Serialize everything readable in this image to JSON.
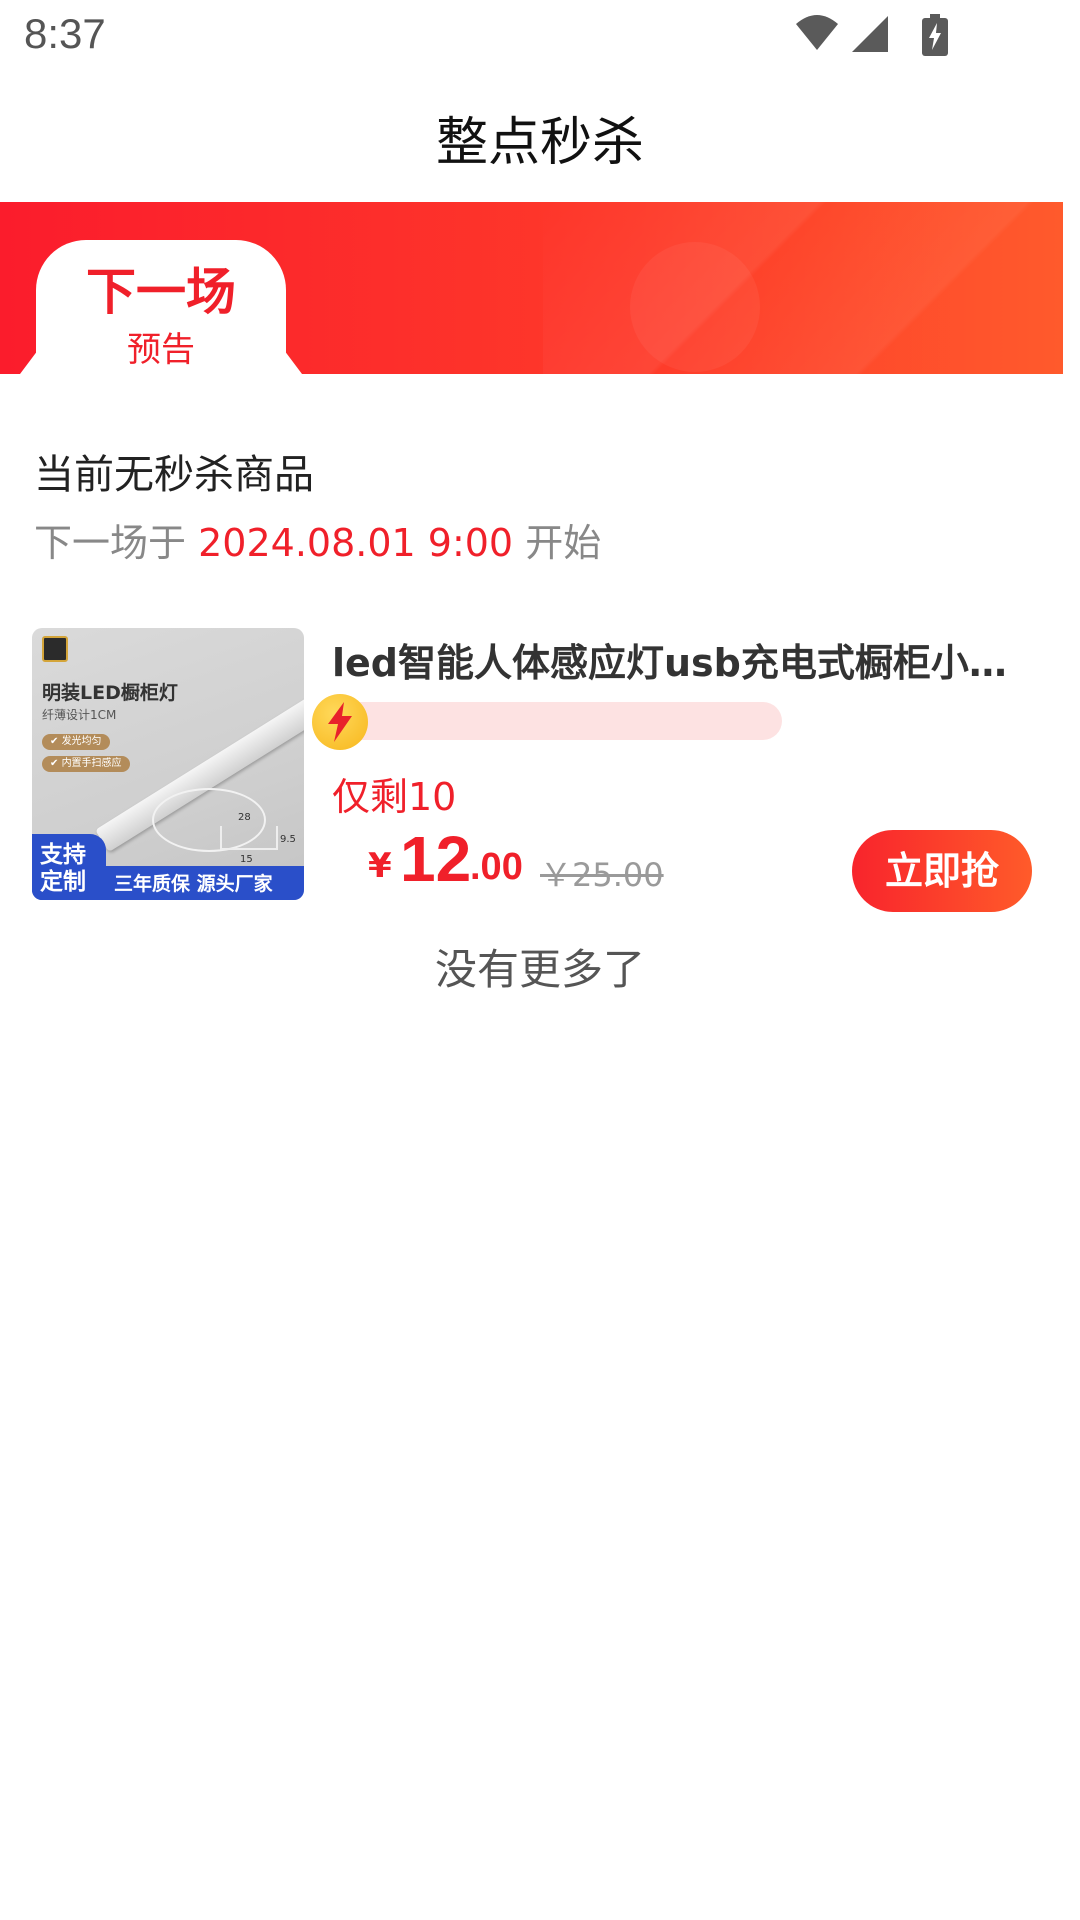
{
  "status_bar": {
    "time": "8:37",
    "icons": [
      "wifi-icon",
      "signal-icon",
      "battery-charging-icon"
    ]
  },
  "header": {
    "title": "整点秒杀"
  },
  "colors": {
    "accent": "#f0202a",
    "banner_start": "#fb1c2c",
    "banner_end": "#ff5a2c",
    "progress_track": "#fde2e2"
  },
  "tabs": [
    {
      "title": "下一场",
      "subtitle": "预告",
      "active": true
    }
  ],
  "notice": {
    "title": "当前无秒杀商品",
    "prefix": "下一场于",
    "time": "2024.08.01 9:00",
    "suffix": "开始"
  },
  "product": {
    "image": {
      "title": "明装LED橱柜灯",
      "subtitle": "纤薄设计1CM",
      "tags": [
        "发光均匀",
        "内置手扫感应"
      ],
      "dimensions": [
        "28",
        "9.5",
        "15"
      ],
      "badge": "支持定制",
      "footer": "三年质保 源头厂家"
    },
    "title": "led智能人体感应灯usb充电式橱柜小夜灯",
    "progress": 0.06,
    "stock": "仅剩10",
    "price_currency": "¥",
    "price_integer": "12",
    "price_decimal": ".00",
    "price_original": "￥25.00",
    "buy_label": "立即抢"
  },
  "end_text": "没有更多了"
}
